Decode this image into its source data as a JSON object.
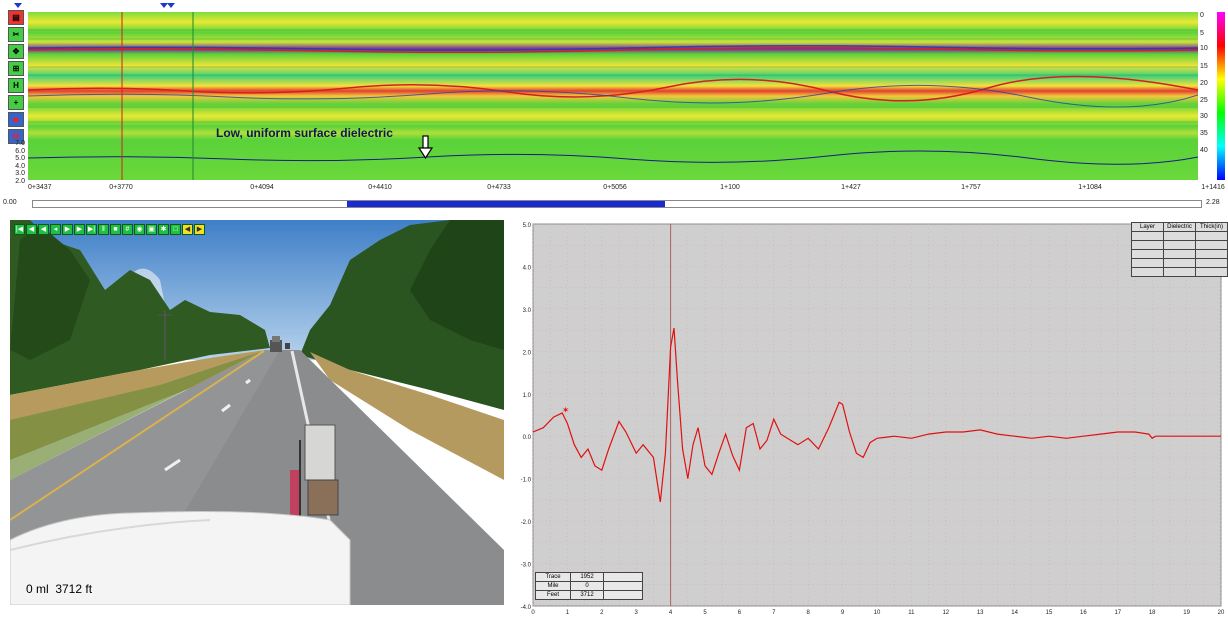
{
  "radar": {
    "annotation": "Low, uniform surface dielectric",
    "dielectric_scale": [
      "7.0",
      "6.0",
      "5.0",
      "4.0",
      "3.0",
      "2.0"
    ],
    "depth_scale": [
      "0",
      "5",
      "10",
      "15",
      "20",
      "25",
      "30",
      "35",
      "40"
    ],
    "stations": [
      "0+3437",
      "0+3770",
      "0+4094",
      "0+4410",
      "0+4733",
      "0+5056",
      "1+100",
      "1+427",
      "1+757",
      "1+1084",
      "1+1416"
    ],
    "scroll_start": "0.00",
    "scroll_end": "2.28",
    "scroll_thumb_fraction": [
      0.27,
      0.54
    ]
  },
  "tools": {
    "icons": [
      "file-icon",
      "cut-icon",
      "move-icon",
      "zoom-icon",
      "hand-icon",
      "plus-icon",
      "mark-icon",
      "m-icon"
    ]
  },
  "video": {
    "caption": "0 ml  3712 ft",
    "toolbar_icons": [
      "first-icon",
      "prev-icon",
      "rewind-icon",
      "back-icon",
      "play-icon",
      "forward-icon",
      "last-icon",
      "pause-icon",
      "stop-icon",
      "grid-icon",
      "camera-icon",
      "save-icon",
      "settings-icon",
      "screen-icon",
      "left-icon",
      "right-icon"
    ]
  },
  "layer_table": {
    "headers": [
      "Layer",
      "Dielectric",
      "Thick(in)"
    ],
    "rows": 5
  },
  "info_table": {
    "rows": [
      {
        "label": "Trace",
        "value": "1952"
      },
      {
        "label": "Mile",
        "value": "0"
      },
      {
        "label": "Feet",
        "value": "3712"
      }
    ]
  },
  "chart_data": {
    "type": "line",
    "title": "",
    "xlabel": "",
    "ylabel": "",
    "xlim": [
      0,
      20
    ],
    "ylim": [
      -4.0,
      5.0
    ],
    "xticks": [
      "0",
      "1",
      "2",
      "3",
      "4",
      "5",
      "6",
      "7",
      "8",
      "9",
      "10",
      "11",
      "12",
      "13",
      "14",
      "15",
      "16",
      "17",
      "18",
      "19",
      "20"
    ],
    "yticks": [
      "5.0",
      "4.0",
      "3.0",
      "2.0",
      "1.0",
      "0.0",
      "-1.0",
      "-2.0",
      "-3.0",
      "-4.0"
    ],
    "cursor_x": 4.0,
    "marker": {
      "x": 0.95,
      "y": 0.62
    },
    "series": [
      {
        "color": "#e01010",
        "x": [
          0,
          0.3,
          0.6,
          0.85,
          1.0,
          1.2,
          1.4,
          1.6,
          1.8,
          2.0,
          2.2,
          2.5,
          2.7,
          3.0,
          3.2,
          3.5,
          3.7,
          3.85,
          4.0,
          4.1,
          4.2,
          4.35,
          4.5,
          4.65,
          4.8,
          5.0,
          5.2,
          5.4,
          5.6,
          5.8,
          6.0,
          6.2,
          6.4,
          6.6,
          6.8,
          7.0,
          7.2,
          7.5,
          7.7,
          8.0,
          8.3,
          8.6,
          8.9,
          9.0,
          9.2,
          9.4,
          9.6,
          9.8,
          10.0,
          10.5,
          11.0,
          11.5,
          12.0,
          12.5,
          13.0,
          13.5,
          14.0,
          14.5,
          15.0,
          15.5,
          16.0,
          16.5,
          17.0,
          17.5,
          17.9,
          18.0,
          18.1,
          18.5,
          19.0,
          19.5,
          20.0
        ],
        "y": [
          0.1,
          0.2,
          0.45,
          0.55,
          0.3,
          -0.2,
          -0.5,
          -0.3,
          -0.7,
          -0.8,
          -0.3,
          0.35,
          0.1,
          -0.4,
          -0.2,
          -0.5,
          -1.55,
          -0.4,
          2.1,
          2.55,
          1.3,
          -0.3,
          -1.0,
          -0.2,
          0.2,
          -0.7,
          -0.9,
          -0.4,
          0.05,
          -0.45,
          -0.8,
          0.2,
          0.3,
          -0.3,
          -0.1,
          0.4,
          0.05,
          -0.1,
          -0.2,
          -0.05,
          -0.3,
          0.2,
          0.8,
          0.75,
          0.1,
          -0.4,
          -0.5,
          -0.15,
          -0.05,
          0.0,
          -0.05,
          0.05,
          0.1,
          0.1,
          0.15,
          0.05,
          0.0,
          -0.05,
          0.0,
          -0.05,
          0.0,
          0.05,
          0.1,
          0.1,
          0.05,
          -0.05,
          0.0,
          0.0,
          0.0,
          0.0,
          0.0
        ]
      }
    ]
  }
}
